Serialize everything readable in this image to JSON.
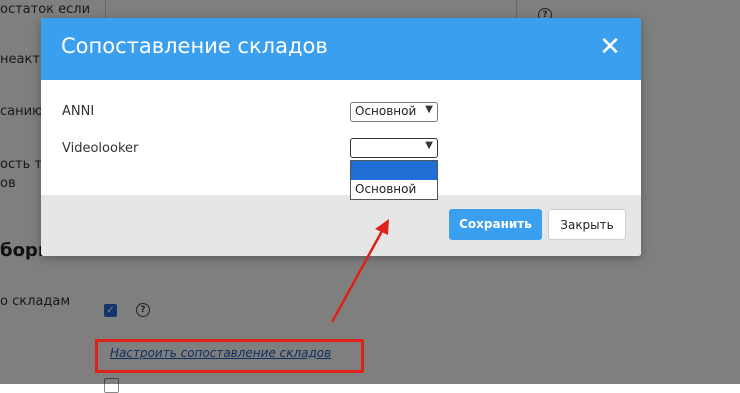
{
  "background": {
    "labels": [
      "остаток если",
      "неактив",
      "санию",
      "ость то",
      "ов",
      "боры п",
      "о складам"
    ],
    "link_text": "Настроить сопоставление складов",
    "help_mark": "?"
  },
  "modal": {
    "title": "Сопоставление складов",
    "rows": [
      {
        "label": "ANNI",
        "selected": "Основной"
      },
      {
        "label": "Videolooker",
        "selected": ""
      }
    ],
    "dropdown_options": [
      "",
      "Основной"
    ],
    "save_label": "Сохранить",
    "close_label": "Закрыть"
  },
  "colors": {
    "header": "#3b9ff0",
    "primary_button": "#3b9ff0",
    "annotation": "#e0201a",
    "selected_option": "#1f6fd6"
  },
  "icons": {
    "close": "close-icon",
    "dropdown": "chevron-down-icon",
    "help": "question-circle-icon",
    "check": "checkmark-icon"
  }
}
